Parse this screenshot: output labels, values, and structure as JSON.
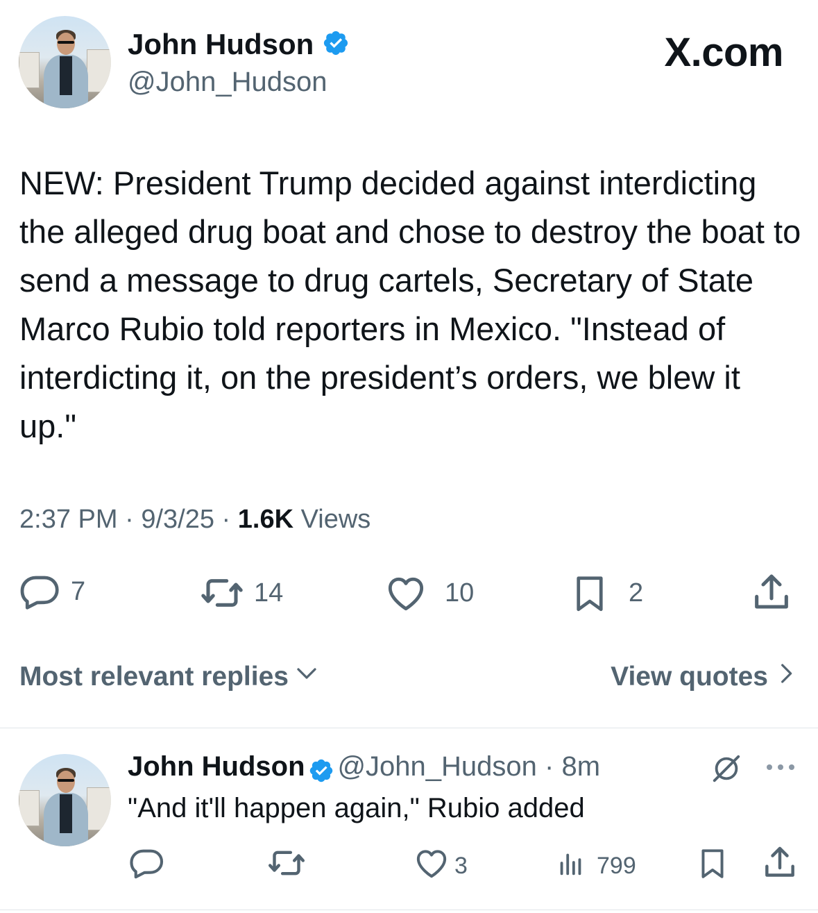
{
  "tweet": {
    "author_name": "John Hudson",
    "author_handle": "@John_Hudson",
    "site_label": "X.com",
    "text": "NEW: President Trump decided against interdicting the alleged drug boat and chose to destroy the boat to send a message to drug cartels, Secretary of State Marco Rubio told reporters in Mexico. \"Instead of interdicting it, on the president’s orders, we blew it up.\"",
    "time": "2:37 PM",
    "date": "9/3/25",
    "separator": "·",
    "views_count": "1.6K",
    "views_label": "Views",
    "replies": "7",
    "reposts": "14",
    "likes": "10",
    "bookmarks": "2"
  },
  "sort_bar": {
    "label": "Most relevant replies",
    "view_quotes": "View quotes"
  },
  "reply": {
    "author_name": "John Hudson",
    "author_handle": "@John_Hudson",
    "separator": "·",
    "age": "8m",
    "text": "\"And it'll happen again,\" Rubio added",
    "likes": "3",
    "views": "799"
  },
  "colors": {
    "verified": "#1d9bf0",
    "secondary_text": "#536471",
    "primary_text": "#0f1419"
  },
  "icons": [
    "verified-badge-icon",
    "reply-icon",
    "repost-icon",
    "like-icon",
    "bookmark-icon",
    "share-icon",
    "chevron-down-icon",
    "chevron-right-icon",
    "grok-icon",
    "more-icon",
    "views-icon"
  ]
}
